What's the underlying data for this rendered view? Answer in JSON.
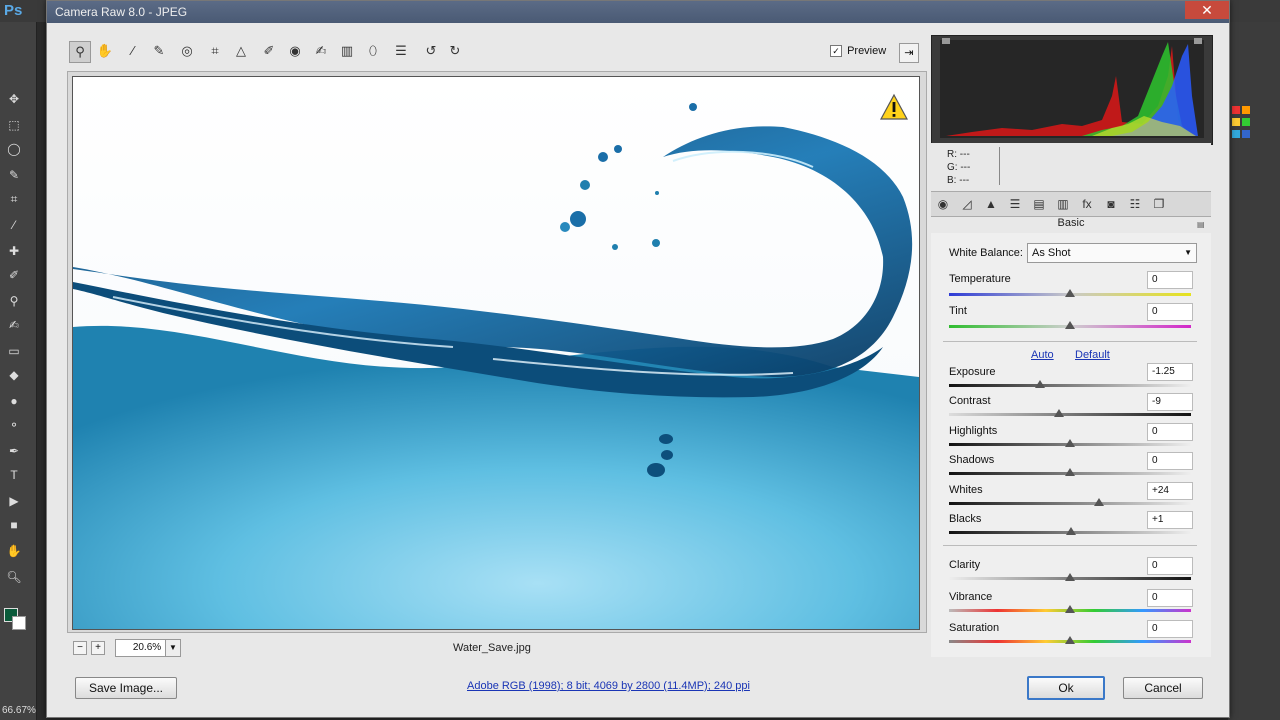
{
  "app": {
    "logo": "Ps",
    "zoom_corner": "66.67%"
  },
  "dialog": {
    "title": "Camera Raw 8.0  -  JPEG",
    "close_glyph": "✕"
  },
  "toolbar": {
    "tools": [
      "zoom-tool",
      "hand-tool",
      "white-balance-tool",
      "color-sampler-tool",
      "targeted-adjustment-tool",
      "crop-tool",
      "straighten-tool",
      "spot-removal-tool",
      "red-eye-removal-tool",
      "adjustment-brush",
      "graduated-filter",
      "radial-filter",
      "open-preferences",
      "rotate-ccw",
      "rotate-cw"
    ],
    "preview_label": "Preview",
    "preview_checked": true
  },
  "canvas": {
    "file_name": "Water_Save.jpg",
    "zoom_value": "20.6%",
    "warning_icon": "warning-icon"
  },
  "histogram": {
    "r_label": "R:",
    "g_label": "G:",
    "b_label": "B:",
    "r_value": "---",
    "g_value": "---",
    "b_value": "---"
  },
  "panel": {
    "section_title": "Basic",
    "white_balance_label": "White Balance:",
    "white_balance_value": "As Shot",
    "auto_label": "Auto",
    "default_label": "Default",
    "sliders": {
      "temperature": {
        "label": "Temperature",
        "value": "0",
        "level": 0.5
      },
      "tint": {
        "label": "Tint",
        "value": "0",
        "level": 0.5
      },
      "exposure": {
        "label": "Exposure",
        "value": "-1.25",
        "level": 0.375
      },
      "contrast": {
        "label": "Contrast",
        "value": "-9",
        "level": 0.455
      },
      "highlights": {
        "label": "Highlights",
        "value": "0",
        "level": 0.5
      },
      "shadows": {
        "label": "Shadows",
        "value": "0",
        "level": 0.5
      },
      "whites": {
        "label": "Whites",
        "value": "+24",
        "level": 0.62
      },
      "blacks": {
        "label": "Blacks",
        "value": "+1",
        "level": 0.505
      },
      "clarity": {
        "label": "Clarity",
        "value": "0",
        "level": 0.5
      },
      "vibrance": {
        "label": "Vibrance",
        "value": "0",
        "level": 0.5
      },
      "saturation": {
        "label": "Saturation",
        "value": "0",
        "level": 0.5
      }
    }
  },
  "footer": {
    "save_label": "Save Image...",
    "info_text": "Adobe RGB (1998); 8 bit; 4069 by 2800 (11.4MP); 240 ppi",
    "ok_label": "Ok",
    "cancel_label": "Cancel"
  },
  "colors": {
    "accent_link": "#1a35b5",
    "titlebar": "#4a5a74",
    "close": "#c74a3c",
    "water": "#1f7fae"
  }
}
